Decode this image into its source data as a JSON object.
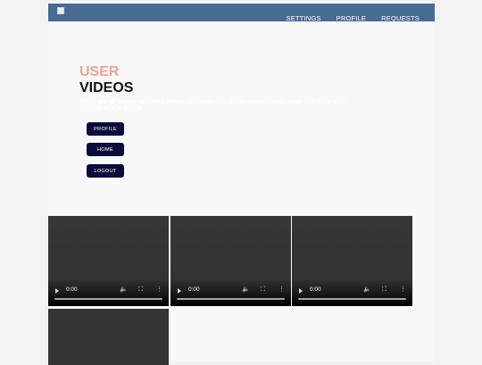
{
  "nav": {
    "links": [
      "SETTINGS",
      "PROFILE",
      "REQUESTS"
    ]
  },
  "hero": {
    "title_line1": "USER",
    "title_line2": "VIDEOS",
    "description": "These are all of your uploaded videos, these are also shown on your public page and Show your ROGUE ROCK ROCK"
  },
  "buttons": {
    "profile": "PROFILE",
    "home": "HOME",
    "logout": "LOGOUT"
  },
  "videos": [
    {
      "time": "0:00"
    },
    {
      "time": "0:00"
    },
    {
      "time": "0:00"
    },
    {
      "time": ""
    }
  ],
  "icons": {
    "logo": "broken-image-icon",
    "play": "play-icon",
    "mute": "volume-icon",
    "fullscreen": "fullscreen-icon",
    "more": "more-vertical-icon"
  },
  "colors": {
    "navbar": "#496b93",
    "title_accent": "#e8a598",
    "button": "#0c0c3a",
    "video_bg": "#333333"
  }
}
